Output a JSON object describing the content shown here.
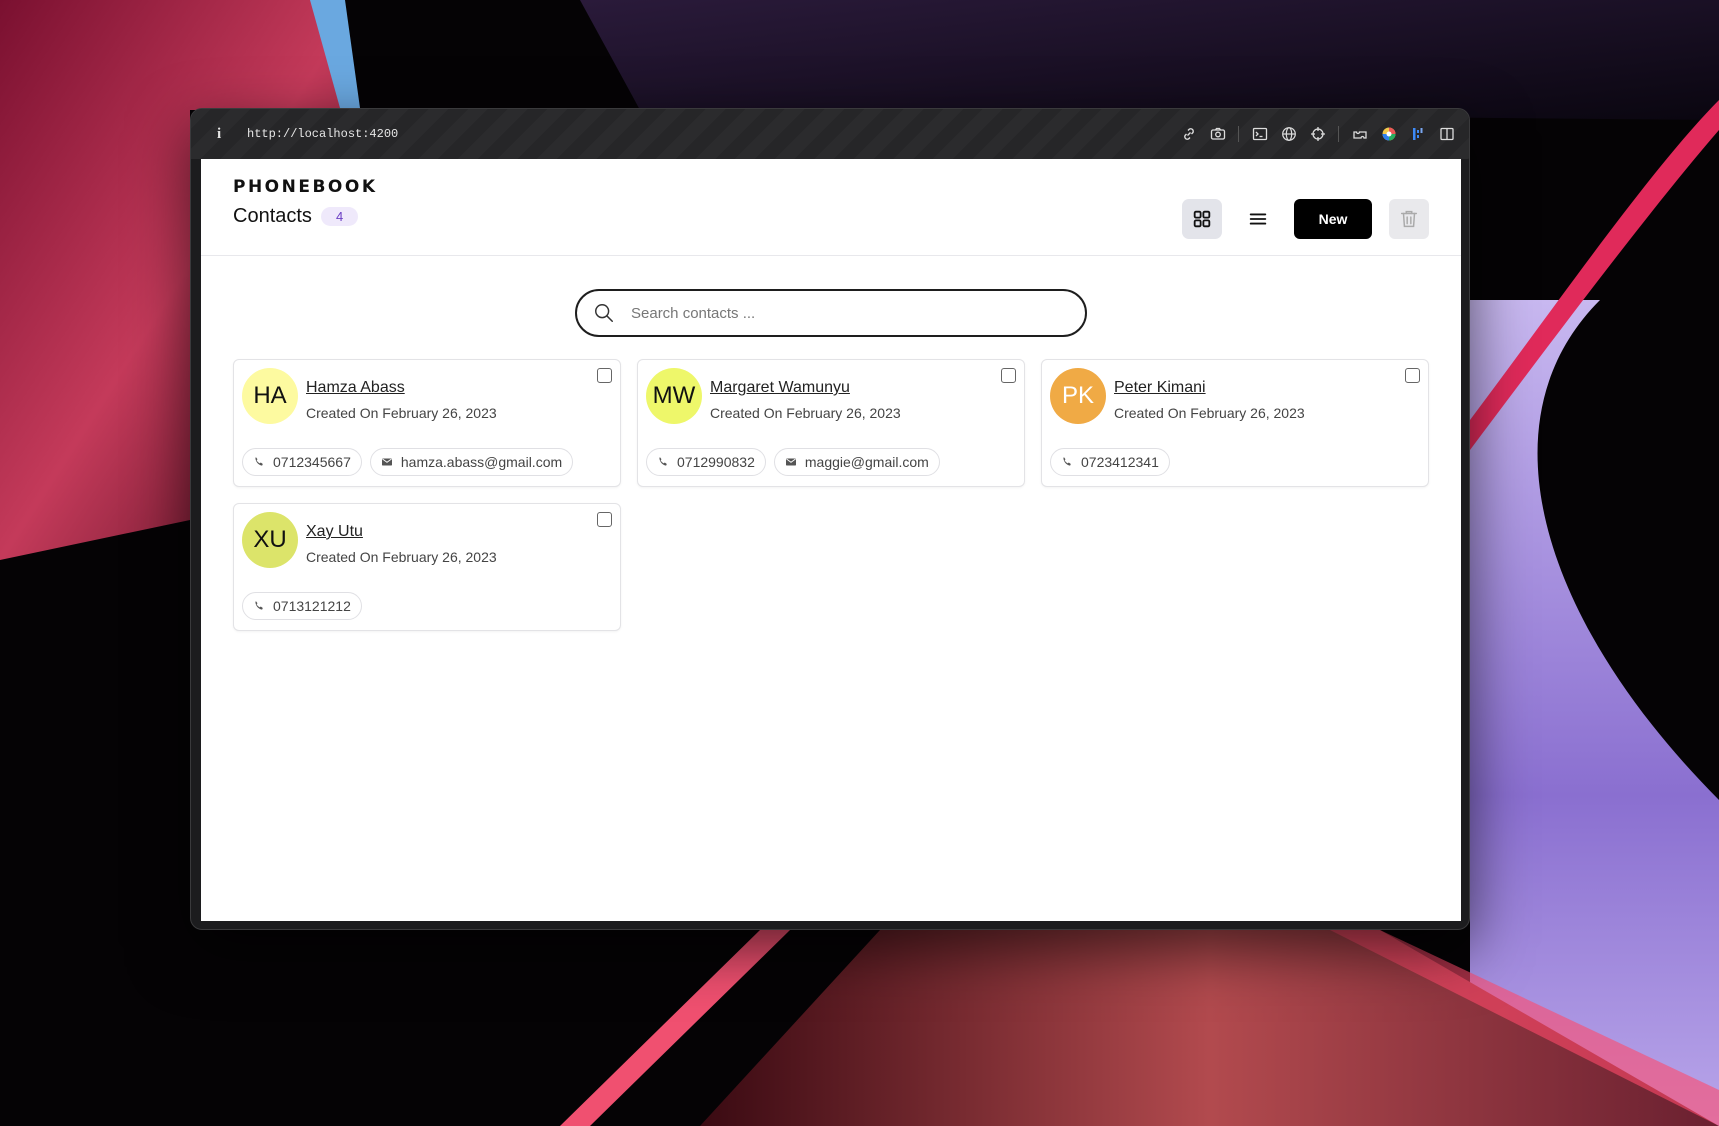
{
  "browser": {
    "info_icon": "i",
    "url": "http://localhost:4200",
    "toolbar_icons": [
      "link-icon",
      "camera-icon",
      "terminal-icon",
      "globe-icon",
      "crosshair-icon",
      "extension-icon",
      "color-wheel-icon",
      "devtools-icon",
      "sidebar-icon"
    ]
  },
  "app": {
    "brand": "PHONEBOOK",
    "title": "Contacts",
    "count": "4",
    "new_label": "New",
    "search_placeholder": "Search contacts ...",
    "accent_color": "#6b3fc4"
  },
  "contacts": [
    {
      "initials": "HA",
      "name": "Hamza Abass",
      "created": "Created On February 26, 2023",
      "phone": "0712345667",
      "email": "hamza.abass@gmail.com",
      "avatar_color": "#fdfaa0"
    },
    {
      "initials": "MW",
      "name": "Margaret Wamunyu",
      "created": "Created On February 26, 2023",
      "phone": "0712990832",
      "email": "maggie@gmail.com",
      "avatar_color": "#eef76a"
    },
    {
      "initials": "PK",
      "name": "Peter Kimani",
      "created": "Created On February 26, 2023",
      "phone": "0723412341",
      "email": "",
      "avatar_color": "#f0aa45"
    },
    {
      "initials": "XU",
      "name": "Xay Utu",
      "created": "Created On February 26, 2023",
      "phone": "0713121212",
      "email": "",
      "avatar_color": "#dce46a"
    }
  ]
}
